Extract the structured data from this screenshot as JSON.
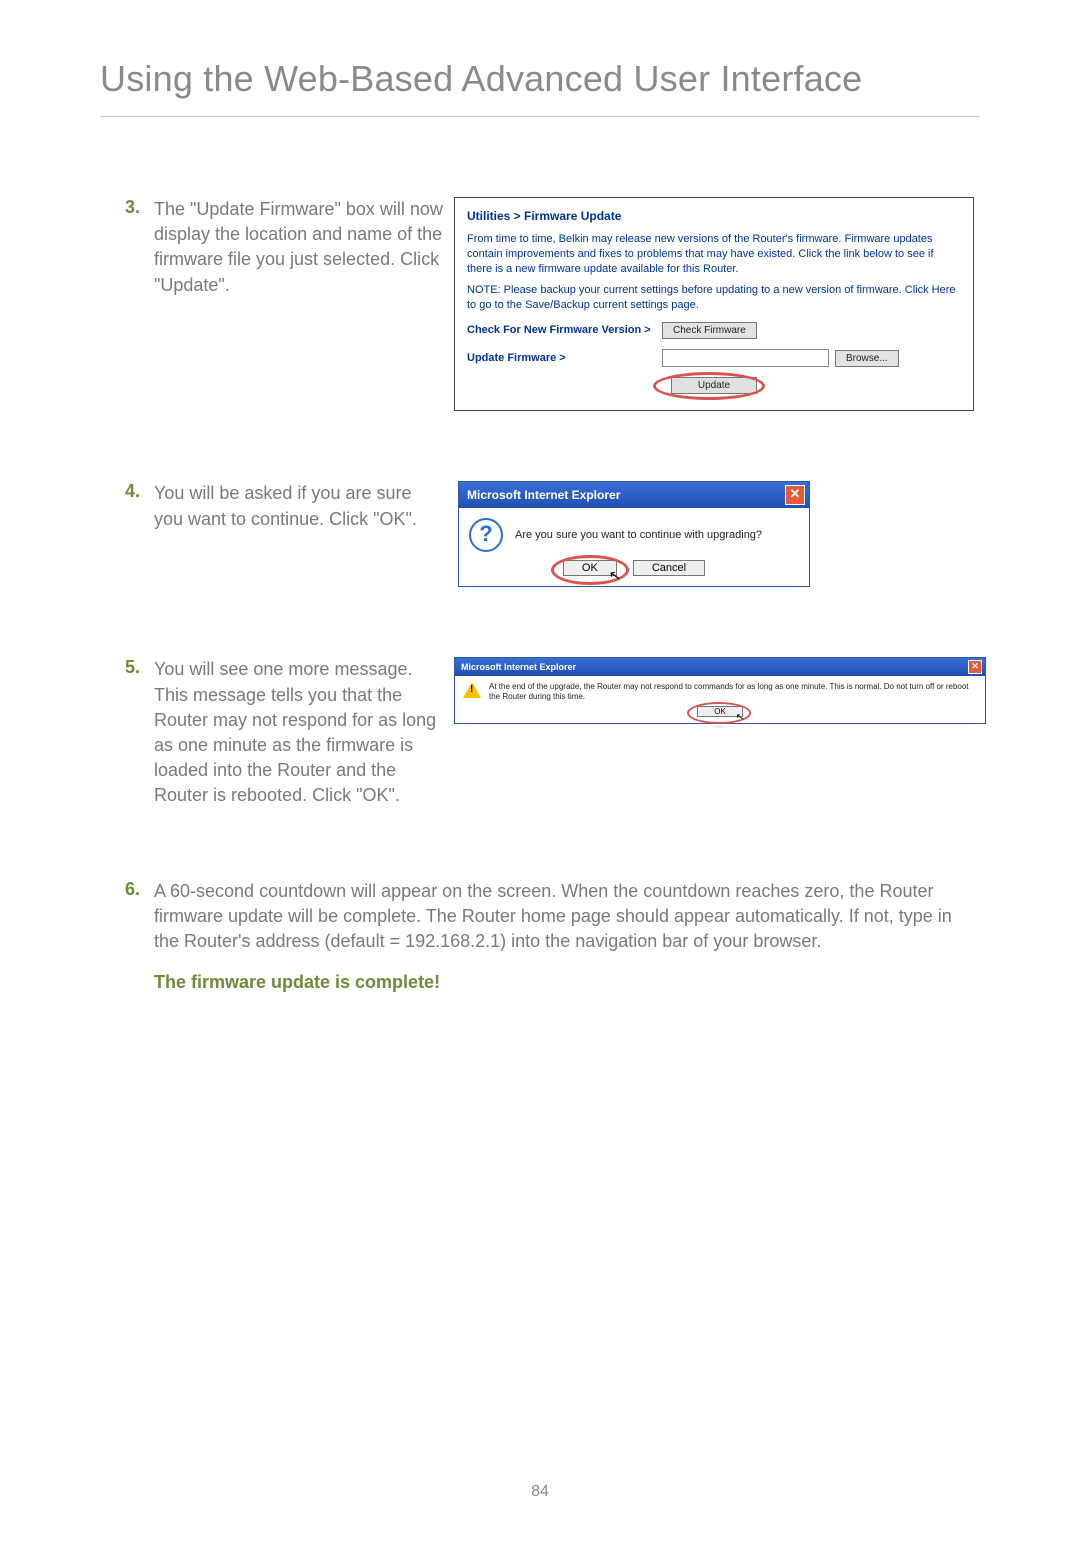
{
  "page_title": "Using the Web-Based Advanced User Interface",
  "page_number": "84",
  "steps": {
    "s3": {
      "num": "3.",
      "text": "The \"Update Firmware\" box will now display the location and name of the firmware file you just selected. Click \"Update\"."
    },
    "s4": {
      "num": "4.",
      "text": "You will be asked if you are sure you want to continue. Click \"OK\"."
    },
    "s5": {
      "num": "5.",
      "text": "You will see one more message. This message tells you that the Router may not respond for as long as one minute as the firmware is loaded into the Router and the Router is rebooted. Click \"OK\"."
    },
    "s6": {
      "num": "6.",
      "text": "A 60-second countdown will appear on the screen. When the countdown reaches zero, the Router firmware update will be complete. The Router home page should appear automatically. If not, type in the Router's address (default = 192.168.2.1) into the navigation bar of your browser."
    }
  },
  "complete_msg": "The firmware update is complete!",
  "fw_panel": {
    "title": "Utilities > Firmware Update",
    "intro": "From time to time, Belkin may release new versions of the Router's firmware. Firmware updates contain improvements and fixes to problems that may have existed. Click the link below to see if there is a new firmware update available for this Router.",
    "note": "NOTE: Please backup your current settings before updating to a new version of firmware. Click Here to go to the Save/Backup current settings page.",
    "check_label": "Check For New Firmware Version >",
    "check_btn": "Check Firmware",
    "update_label": "Update Firmware >",
    "browse_btn": "Browse...",
    "update_btn": "Update"
  },
  "dialog1": {
    "title": "Microsoft Internet Explorer",
    "message": "Are you sure you want to continue with upgrading?",
    "ok": "OK",
    "cancel": "Cancel"
  },
  "dialog2": {
    "title": "Microsoft Internet Explorer",
    "message": "At the end of the upgrade, the Router may not respond to commands for as long as one minute. This is normal. Do not turn off or reboot the Router during this time.",
    "ok": "OK"
  }
}
